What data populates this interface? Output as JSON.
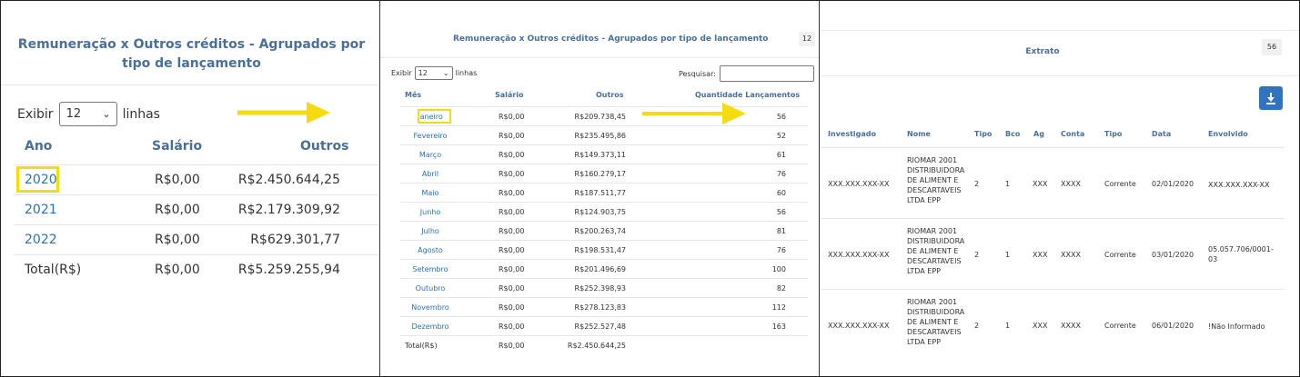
{
  "panel1": {
    "title": "Remuneração x Outros créditos - Agrupados por tipo de lançamento",
    "show_label": "Exibir",
    "show_value": "12",
    "lines_label": "linhas",
    "headers": {
      "ano": "Ano",
      "salario": "Salário",
      "outros": "Outros"
    },
    "rows": [
      {
        "ano": "2020",
        "salario": "R$0,00",
        "outros": "R$2.450.644,25"
      },
      {
        "ano": "2021",
        "salario": "R$0,00",
        "outros": "R$2.179.309,92"
      },
      {
        "ano": "2022",
        "salario": "R$0,00",
        "outros": "R$629.301,77"
      }
    ],
    "total": {
      "label": "Total(R$)",
      "salario": "R$0,00",
      "outros": "R$5.259.255,94"
    }
  },
  "panel2": {
    "title": "Remuneração x Outros créditos - Agrupados por tipo de lançamento",
    "badge": "12",
    "show_label": "Exibir",
    "show_value": "12",
    "lines_label": "linhas",
    "search_label": "Pesquisar:",
    "headers": {
      "mes": "Mês",
      "salario": "Salário",
      "outros": "Outros",
      "qtd": "Quantidade Lançamentos"
    },
    "rows": [
      {
        "mes": "Janeiro",
        "salario": "R$0,00",
        "outros": "R$209.738,45",
        "qtd": "56"
      },
      {
        "mes": "Fevereiro",
        "salario": "R$0,00",
        "outros": "R$235.495,86",
        "qtd": "52"
      },
      {
        "mes": "Março",
        "salario": "R$0,00",
        "outros": "R$149.373,11",
        "qtd": "61"
      },
      {
        "mes": "Abril",
        "salario": "R$0,00",
        "outros": "R$160.279,17",
        "qtd": "76"
      },
      {
        "mes": "Maio",
        "salario": "R$0,00",
        "outros": "R$187.511,77",
        "qtd": "60"
      },
      {
        "mes": "Junho",
        "salario": "R$0,00",
        "outros": "R$124.903,75",
        "qtd": "56"
      },
      {
        "mes": "Julho",
        "salario": "R$0,00",
        "outros": "R$200.263,74",
        "qtd": "81"
      },
      {
        "mes": "Agosto",
        "salario": "R$0,00",
        "outros": "R$198.531,47",
        "qtd": "76"
      },
      {
        "mes": "Setembro",
        "salario": "R$0,00",
        "outros": "R$201.496,69",
        "qtd": "100"
      },
      {
        "mes": "Outubro",
        "salario": "R$0,00",
        "outros": "R$252.398,93",
        "qtd": "82"
      },
      {
        "mes": "Novembro",
        "salario": "R$0,00",
        "outros": "R$278.123,83",
        "qtd": "112"
      },
      {
        "mes": "Dezembro",
        "salario": "R$0,00",
        "outros": "R$252.527,48",
        "qtd": "163"
      }
    ],
    "total": {
      "label": "Total(R$)",
      "salario": "R$0,00",
      "outros": "R$2.450.644,25"
    }
  },
  "panel3": {
    "title": "Extrato",
    "badge": "56",
    "download_icon": "download-icon",
    "headers": {
      "investigado": "Investigado",
      "nome": "Nome",
      "tipo": "Tipo",
      "bco": "Bco",
      "ag": "Ag",
      "conta": "Conta",
      "tipo2": "Tipo",
      "data": "Data",
      "envolvido": "Envolvido"
    },
    "rows": [
      {
        "investigado": "XXX.XXX.XXX-XX",
        "nome": "RIOMAR 2001 DISTRIBUIDORA DE ALIMENT E DESCARTAVEIS LTDA EPP",
        "tipo": "2",
        "bco": "1",
        "ag": "XXX",
        "conta": "XXXX",
        "tipo2": "Corrente",
        "data": "02/01/2020",
        "envolvido": "XXX.XXX.XXX-XX"
      },
      {
        "investigado": "XXX.XXX.XXX-XX",
        "nome": "RIOMAR 2001 DISTRIBUIDORA DE ALIMENT E DESCARTAVEIS LTDA EPP",
        "tipo": "2",
        "bco": "1",
        "ag": "XXX",
        "conta": "XXXX",
        "tipo2": "Corrente",
        "data": "03/01/2020",
        "envolvido": "05.057.706/0001-03"
      },
      {
        "investigado": "XXX.XXX.XXX-XX",
        "nome": "RIOMAR 2001 DISTRIBUIDORA DE ALIMENT E DESCARTAVEIS LTDA EPP",
        "tipo": "2",
        "bco": "1",
        "ag": "XXX",
        "conta": "XXXX",
        "tipo2": "Corrente",
        "data": "06/01/2020",
        "envolvido": "!Não Informado"
      }
    ]
  },
  "colors": {
    "link": "#2e6fb8",
    "header": "#4a6f98",
    "highlight": "#f5dc0f",
    "button": "#2f74c0"
  }
}
